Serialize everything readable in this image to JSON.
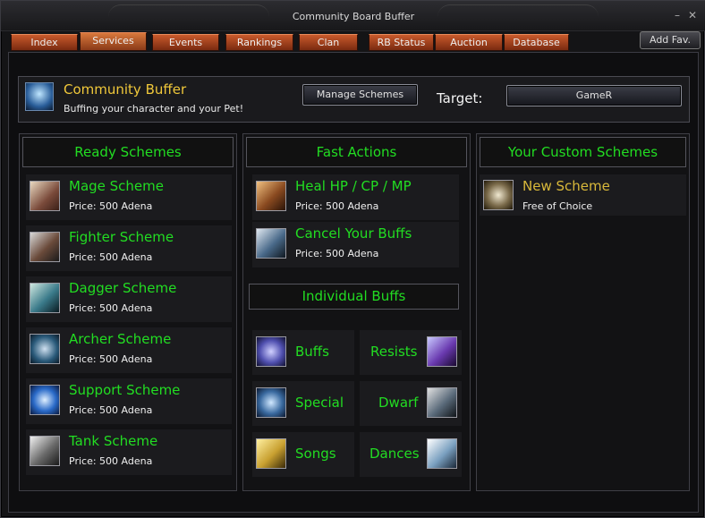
{
  "window": {
    "title": "Community Board Buffer"
  },
  "tabs": [
    {
      "label": "Index"
    },
    {
      "label": "Services"
    },
    {
      "label": "Events"
    },
    {
      "label": "Rankings"
    },
    {
      "label": "Clan"
    },
    {
      "label": "RB Status"
    },
    {
      "label": "Auction"
    },
    {
      "label": "Database"
    }
  ],
  "active_tab": "Services",
  "add_fav_label": "Add Fav.",
  "header": {
    "title": "Community Buffer",
    "subtitle": "Buffing your character and your Pet!",
    "manage_label": "Manage Schemes",
    "target_label": "Target:",
    "target_value": "GameR"
  },
  "ready": {
    "heading": "Ready Schemes",
    "items": [
      {
        "name": "Mage Scheme",
        "price": "Price: 500 Adena",
        "icon": "mage-icon"
      },
      {
        "name": "Fighter Scheme",
        "price": "Price: 500 Adena",
        "icon": "fighter-icon"
      },
      {
        "name": "Dagger Scheme",
        "price": "Price: 500 Adena",
        "icon": "dagger-icon"
      },
      {
        "name": "Archer Scheme",
        "price": "Price: 500 Adena",
        "icon": "archer-icon"
      },
      {
        "name": "Support Scheme",
        "price": "Price: 500 Adena",
        "icon": "support-icon"
      },
      {
        "name": "Tank Scheme",
        "price": "Price: 500 Adena",
        "icon": "tank-icon"
      }
    ]
  },
  "fast": {
    "heading": "Fast Actions",
    "items": [
      {
        "name": "Heal HP / CP / MP",
        "price": "Price: 500 Adena",
        "icon": "heal-icon"
      },
      {
        "name": "Cancel Your Buffs",
        "price": "Price: 500 Adena",
        "icon": "cancel-icon"
      }
    ],
    "individual_heading": "Individual Buffs",
    "individual": [
      {
        "label": "Buffs",
        "icon": "buffs-icon"
      },
      {
        "label": "Resists",
        "icon": "resists-icon"
      },
      {
        "label": "Special",
        "icon": "special-icon"
      },
      {
        "label": "Dwarf",
        "icon": "dwarf-icon"
      },
      {
        "label": "Songs",
        "icon": "songs-icon"
      },
      {
        "label": "Dances",
        "icon": "dances-icon"
      }
    ]
  },
  "custom": {
    "heading": "Your Custom Schemes",
    "items": [
      {
        "name": "New Scheme",
        "price": "Free of Choice",
        "icon": "new-scheme-icon"
      }
    ]
  },
  "colors": {
    "accent_green": "#22dd22",
    "gold": "#f0c83a",
    "tab_orange": "#c95a2c"
  }
}
